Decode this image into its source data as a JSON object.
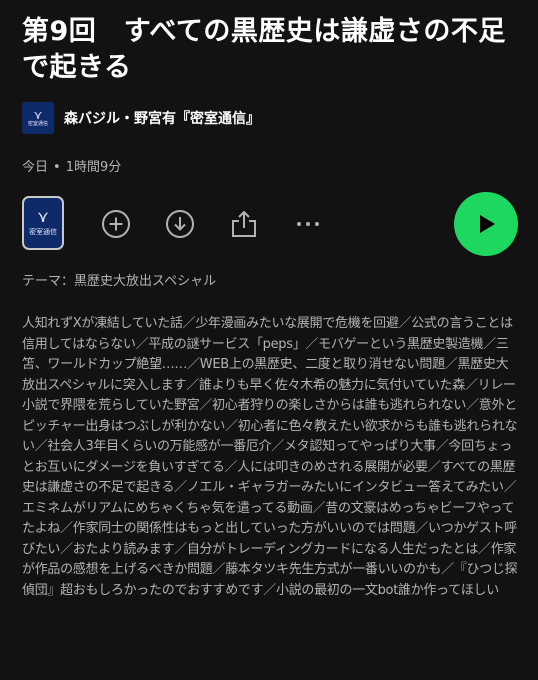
{
  "episode": {
    "title": "第9回　すべての黒歴史は謙虚さの不足で起きる"
  },
  "show": {
    "thumb_text": "密室通信",
    "name": "森バジル・野宮有『密室通信』"
  },
  "meta": {
    "date": "今日",
    "separator": "•",
    "duration": "1時間9分"
  },
  "controls": {
    "cover_text": "密室通信",
    "icons": {
      "add": "plus-circle-icon",
      "download": "download-circle-icon",
      "share": "share-icon",
      "more": "more-icon",
      "play": "play-icon"
    },
    "play_color": "#1ed760"
  },
  "description": {
    "theme": "テーマ：黒歴史大放出スペシャル",
    "body": "人知れずXが凍結していた話／少年漫画みたいな展開で危機を回避／公式の言うことは信用してはならない／平成の謎サービス「peps」／モバゲーという黒歴史製造機／三笘、ワールドカップ絶望……／WEB上の黒歴史、二度と取り消せない問題／黒歴史大放出スペシャルに突入します／誰よりも早く佐々木希の魅力に気付いていた森／リレー小説で界隈を荒らしていた野宮／初心者狩りの楽しさからは誰も逃れられない／意外とピッチャー出身はつぶしが利かない／初心者に色々教えたい欲求からも誰も逃れられない／社会人3年目くらいの万能感が一番厄介／メタ認知ってやっぱり大事／今回ちょっとお互いにダメージを負いすぎてる／人には叩きのめされる展開が必要／すべての黒歴史は謙虚さの不足で起きる／ノエル・ギャラガーみたいにインタビュー答えてみたい／エミネムがリアムにめちゃくちゃ気を遣ってる動画／昔の文豪はめっちゃビーフやってたよね／作家同士の関係性はもっと出していった方がいいのでは問題／いつかゲスト呼びたい／おたより読みます／自分がトレーディングカードになる人生だったとは／作家が作品の感想を上げるべきか問題／藤本タツキ先生方式が一番いいのかも／『ひつじ探偵団』超おもしろかったのでおすすめです／小説の最初の一文bot誰か作ってほしい"
  }
}
